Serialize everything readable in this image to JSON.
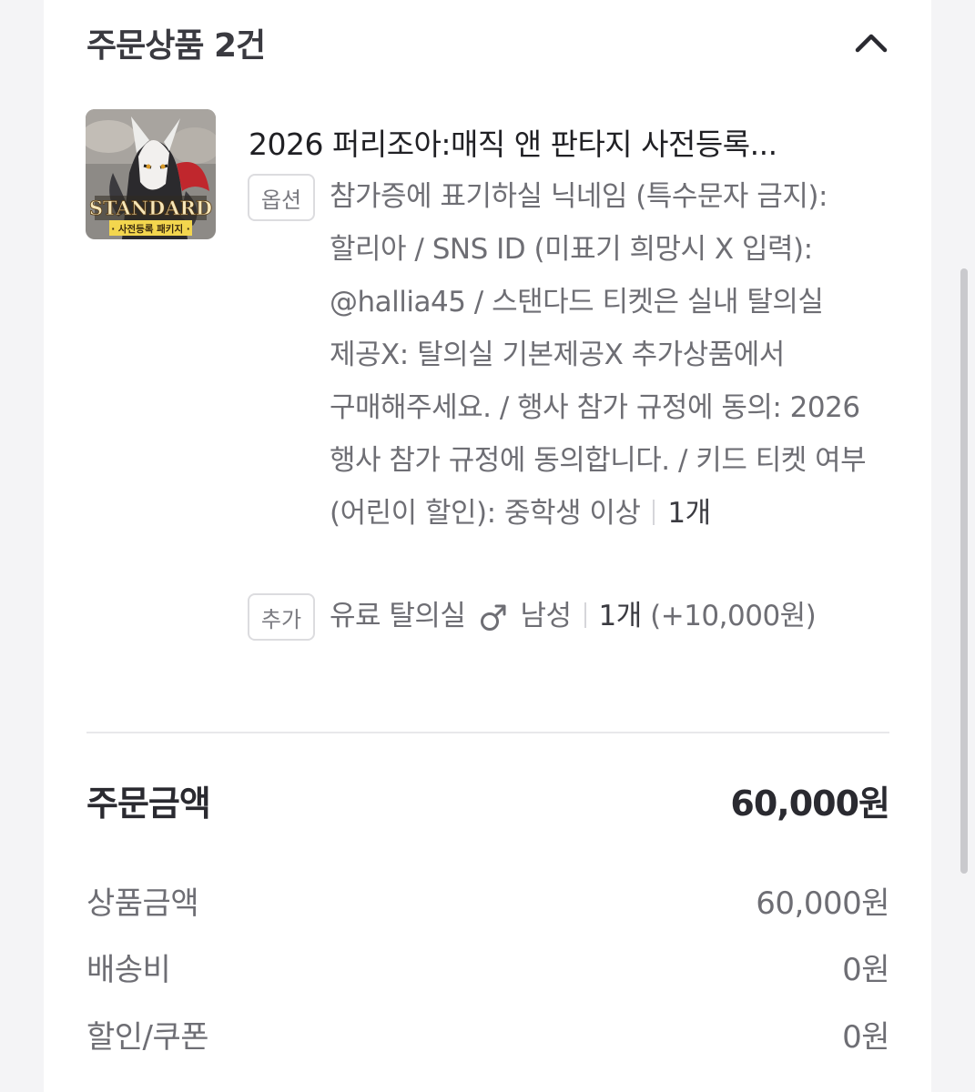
{
  "order_items": {
    "title": "주문상품 2건",
    "collapse_icon": "chevron-up-icon"
  },
  "product": {
    "name": "2026 퍼리조아:매직 앤 판타지 사전등록...",
    "thumbnail": {
      "badge_text": "STANDARD",
      "badge_subtext": "· 사전등록 패키지 ·"
    },
    "option": {
      "tag": "옵션",
      "text": "참가증에 표기하실 닉네임 (특수문자 금지): 할리아 / SNS ID (미표기 희망시 X 입력): @hallia45 / 스탠다드 티켓은 실내 탈의실 제공X: 탈의실 기본제공X 추가상품에서 구매해주세요. / 행사 참가 규정에 동의: 2026 행사 참가 규정에 동의합니다. / 키드 티켓 여부 (어린이 할인): 중학생 이상",
      "quantity": "1개"
    },
    "addon": {
      "tag": "추가",
      "name": "유료 탈의실",
      "gender_icon": "male-icon",
      "gender": "남성",
      "quantity": "1개",
      "price": "(+10,000원)"
    }
  },
  "summary": {
    "total_label": "주문금액",
    "total_value": "60,000원",
    "rows": [
      {
        "label": "상품금액",
        "value": "60,000원"
      },
      {
        "label": "배송비",
        "value": "0원"
      },
      {
        "label": "할인/쿠폰",
        "value": "0원"
      }
    ]
  }
}
